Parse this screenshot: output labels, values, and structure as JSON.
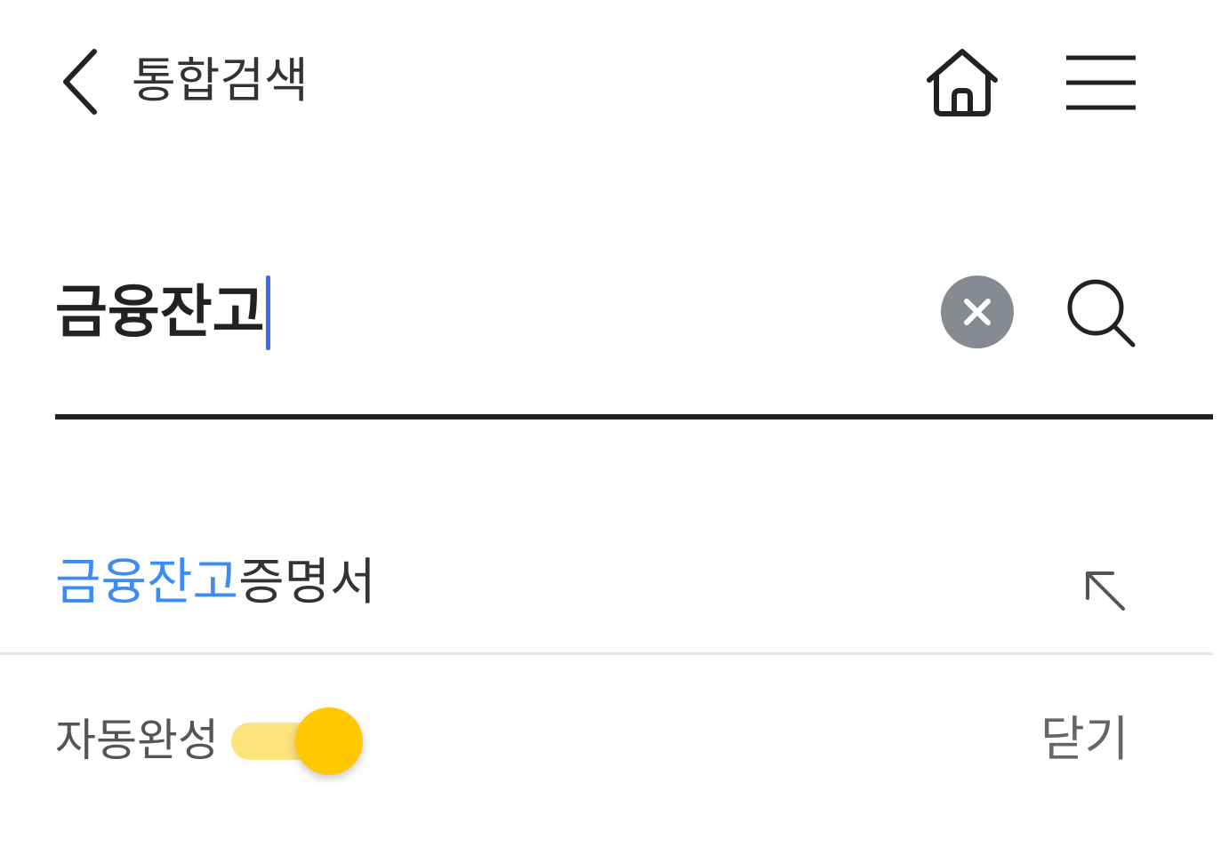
{
  "header": {
    "title": "통합검색",
    "back_icon": "chevron-left-icon",
    "home_icon": "home-icon",
    "menu_icon": "hamburger-menu-icon"
  },
  "search": {
    "value": "금융잔고",
    "clear_icon": "clear-icon",
    "search_icon": "search-icon"
  },
  "suggestions": [
    {
      "match": "금융잔고",
      "rest": "증명서",
      "fill_icon": "arrow-up-left-icon"
    }
  ],
  "footer": {
    "autocomplete_label": "자동완성",
    "autocomplete_on": true,
    "close_label": "닫기"
  },
  "colors": {
    "caret": "#3b6cf6",
    "highlight": "#3d8bf5",
    "toggle_knob": "#ffc800",
    "toggle_track": "#fde37c",
    "clear_button": "#868b92",
    "underline": "#222222"
  }
}
